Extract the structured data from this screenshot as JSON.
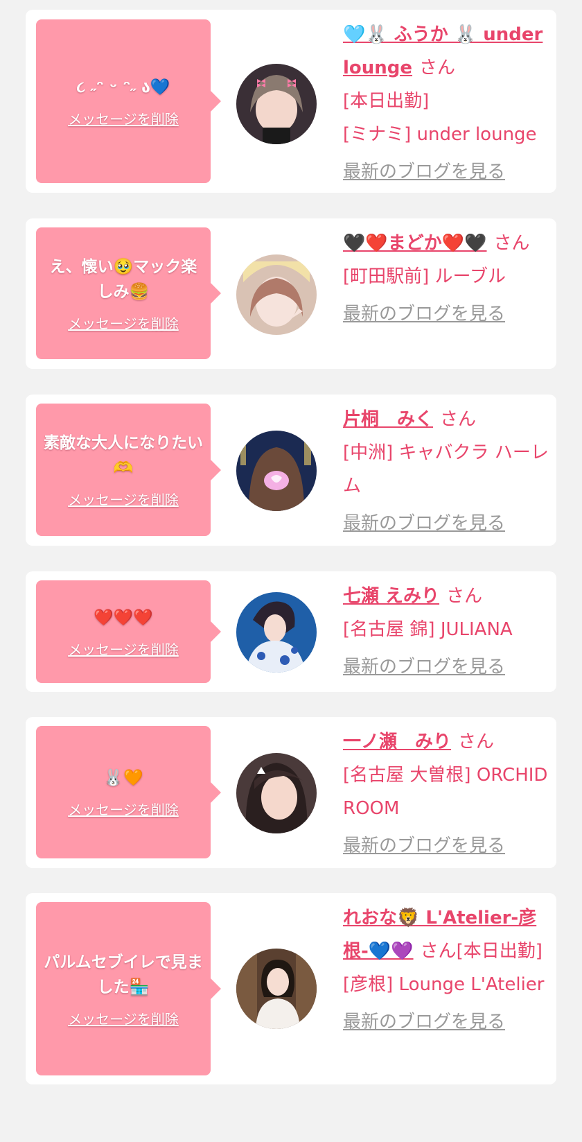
{
  "delete_label": "メッセージを削除",
  "san_label": "さん",
  "blog_label": "最新のブログを見る",
  "colors": {
    "page_bg": "#f2f2f2",
    "bubble": "#ff99aa",
    "accent": "#e8456b",
    "muted": "#999999"
  },
  "cards": [
    {
      "message": "૮ ˶ᵔ ᵕ ᵔ˶ ა💙",
      "name": "🩵🐰 ふうか 🐰 under lounge",
      "shop_line1": "[本日出勤]",
      "shop_line2": "[ミナミ] under lounge"
    },
    {
      "message": "え、懐い🥹マック楽しみ🍔",
      "name": "🖤❤️まどか❤️🖤",
      "shop_line1": "[町田駅前] ルーブル",
      "shop_line2": ""
    },
    {
      "message": "素敵な大人になりたい🫶",
      "name": "片桐　みく",
      "shop_line1": "[中洲] キャバクラ ハーレム",
      "shop_line2": ""
    },
    {
      "message": "❤️❤️❤️",
      "name": "七瀬 えみり",
      "shop_line1": "[名古屋 錦] JULIANA",
      "shop_line2": ""
    },
    {
      "message": "🐰🧡",
      "name": "一ノ瀬　みり",
      "shop_line1": "[名古屋 大曽根] ORCHID ROOM",
      "shop_line2": ""
    },
    {
      "message": "パルムセブイレで見ました🏪",
      "name": "れおな🦁 L'Atelier-彦根-💙💜",
      "shop_line1": "[本日出勤]",
      "shop_line2": "[彦根] Lounge L'Atelier"
    }
  ]
}
